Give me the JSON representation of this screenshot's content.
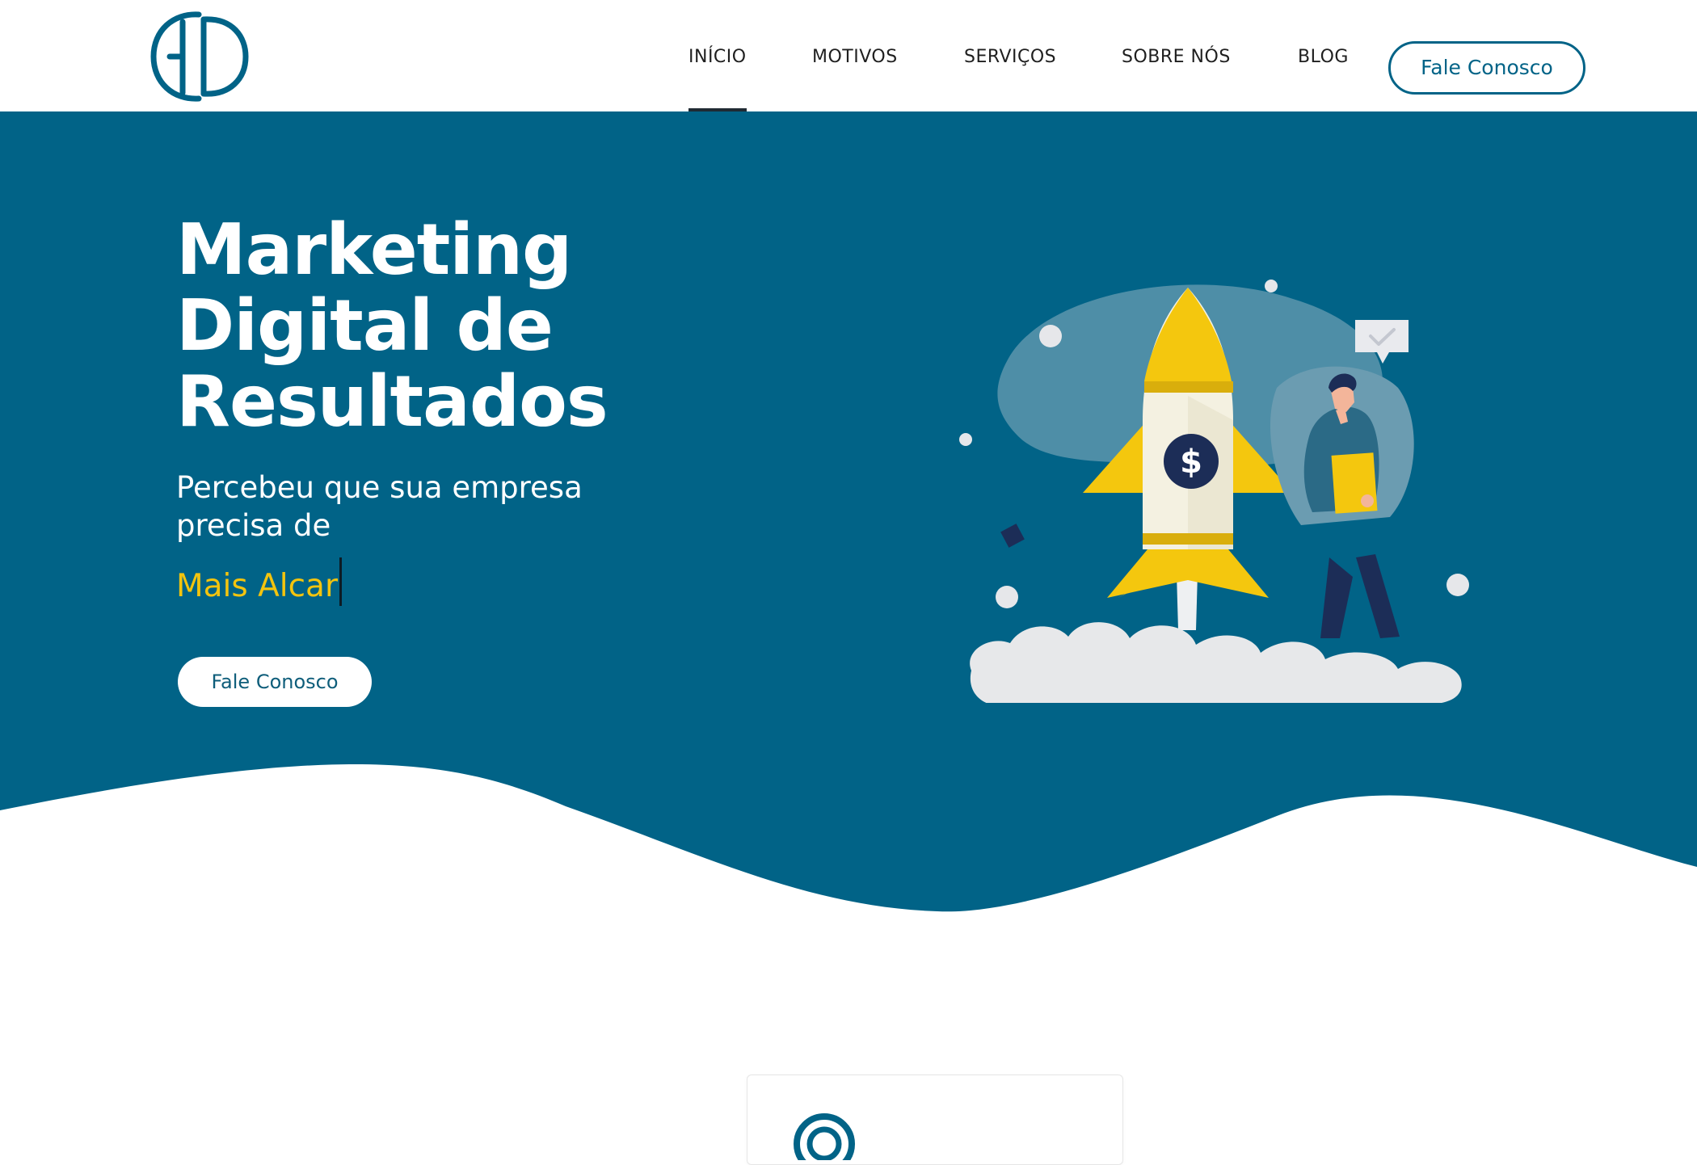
{
  "brand": {
    "logo_text": "ED",
    "primary_color": "#016387",
    "accent_color": "#f3c40e"
  },
  "nav": {
    "items": [
      {
        "label": "INÍCIO",
        "active": true
      },
      {
        "label": "MOTIVOS",
        "active": false
      },
      {
        "label": "SERVIÇOS",
        "active": false
      },
      {
        "label": "SOBRE NÓS",
        "active": false
      },
      {
        "label": "BLOG",
        "active": false
      }
    ],
    "cta_label": "Fale Conosco"
  },
  "hero": {
    "title_lines": [
      "Marketing",
      "Digital de",
      "Resultados"
    ],
    "subtitle": "Percebeu que sua empresa precisa de",
    "typed_text": "Mais Alcar",
    "cta_label": "Fale Conosco",
    "illustration": {
      "rocket_icon": "dollar-sign-icon",
      "speech_bubble_icon": "checkmark-icon"
    }
  },
  "feature_card": {
    "icon": "target-icon"
  }
}
